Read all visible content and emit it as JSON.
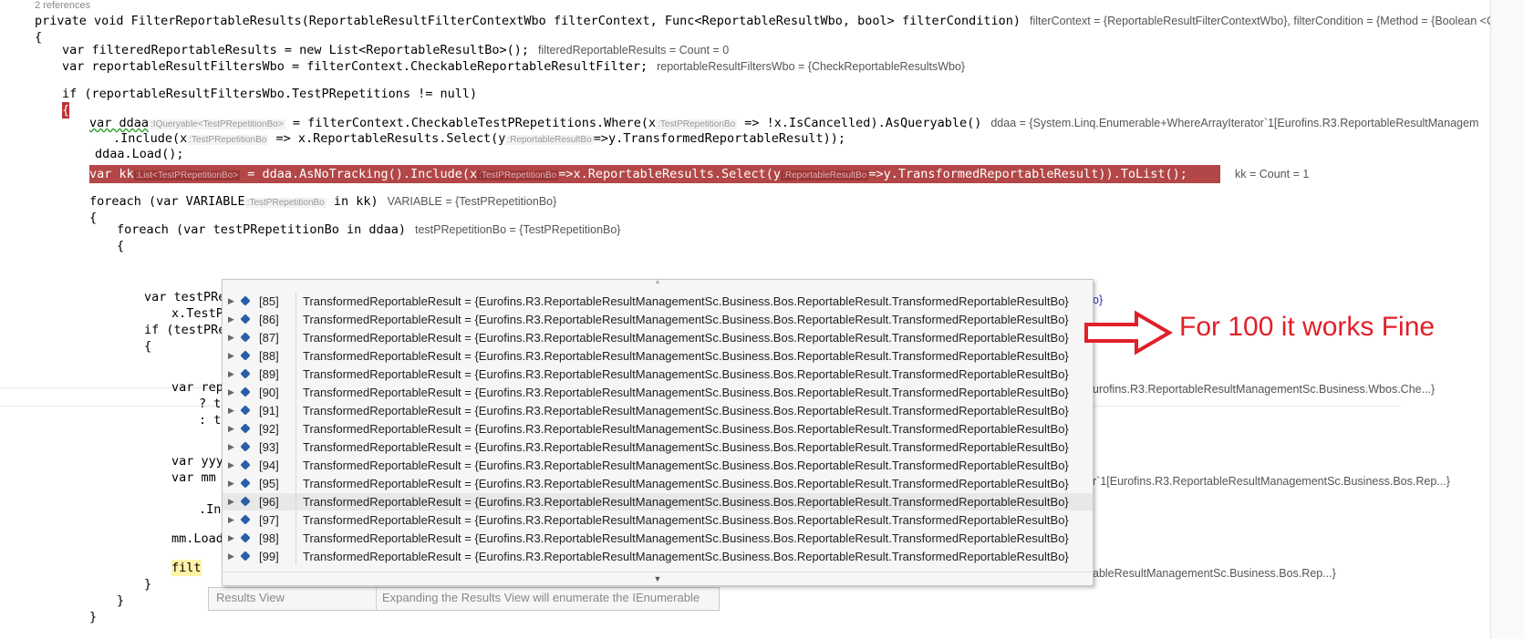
{
  "header": {
    "references": "2 references"
  },
  "code": {
    "l1": "private void FilterReportableResults(ReportableResultFilterContextWbo filterContext, Func<ReportableResultWbo, bool> filterCondition)",
    "l1_dt": "filterContext = {ReportableResultFilterContextWbo}, filterCondition = {Method = {Boolean <ConvertU",
    "l2": "{",
    "l3": "var filteredReportableResults = new List<ReportableResultBo>();",
    "l3_dt": "filteredReportableResults = Count = 0",
    "l4": "var reportableResultFiltersWbo = filterContext.CheckableReportableResultFilter;",
    "l4_dt": "reportableResultFiltersWbo = {CheckReportableResultsWbo}",
    "l5": "if (reportableResultFiltersWbo.TestPRepetitions != null)",
    "l6": "{",
    "l7a": "var ddaa",
    "l7h1": ":IQueryable<TestPRepetitionBo>",
    "l7b": " = filterContext.CheckableTestPRepetitions.Where(x",
    "l7h2": ":TestPRepetitionBo",
    "l7c": " => !x.IsCancelled).AsQueryable()",
    "l7_dt": "ddaa = {System.Linq.Enumerable+WhereArrayIterator`1[Eurofins.R3.ReportableResultManagem",
    "l8a": ".Include(x",
    "l8h1": ":TestPRepetitionBo",
    "l8b": " => x.ReportableResults.Select(y",
    "l8h2": ":ReportableResultBo",
    "l8c": "=>y.TransformedReportableResult));",
    "l9": "ddaa.Load();",
    "l10a": "var kk",
    "l10h1": ":List<TestPRepetitionBo>",
    "l10b": " = ddaa.AsNoTracking().Include(x",
    "l10h2": ":TestPRepetitionBo",
    "l10c": "=>x.ReportableResults.Select(y",
    "l10h3": ":ReportableResultBo",
    "l10d": "=>y.TransformedReportableResult)).ToList();",
    "l10_dt": "kk = Count = 1",
    "l11a": "foreach (var VARIABLE",
    "l11h": ":TestPRepetitionBo",
    "l11b": " in kk)",
    "l11_dt": "VARIABLE = {TestPRepetitionBo}",
    "l12": "{",
    "l13": "foreach (var testPRepetitionBo in ddaa)",
    "l13_dt": "testPRepetitionBo = {TestPRepetitionBo}",
    "l14": "{",
    "l15": "var testPRe",
    "l16": "x.TestP",
    "l17": "if (testPRe",
    "l18": "{",
    "l19": "var rep",
    "l20": "? t",
    "l21": ": t",
    "l22": "var yyy",
    "l23": "var mm",
    "l24": ".In",
    "l25": "mm.Load",
    "l26": "filt",
    "l27": "}",
    "l28": "}",
    "l29": "}"
  },
  "annotations": {
    "a1": "o}",
    "a2": "urofins.R3.ReportableResultManagementSc.Business.Wbos.Che...}",
    "a3": "r`1[Eurofins.R3.ReportableResultManagementSc.Business.Bos.Rep...}",
    "a4": "ableResultManagementSc.Business.Bos.Rep...}"
  },
  "tooltip": {
    "rows": [
      {
        "index": "[85]",
        "value": "TransformedReportableResult = {Eurofins.R3.ReportableResultManagementSc.Business.Bos.ReportableResult.TransformedReportableResultBo}"
      },
      {
        "index": "[86]",
        "value": "TransformedReportableResult = {Eurofins.R3.ReportableResultManagementSc.Business.Bos.ReportableResult.TransformedReportableResultBo}"
      },
      {
        "index": "[87]",
        "value": "TransformedReportableResult = {Eurofins.R3.ReportableResultManagementSc.Business.Bos.ReportableResult.TransformedReportableResultBo}"
      },
      {
        "index": "[88]",
        "value": "TransformedReportableResult = {Eurofins.R3.ReportableResultManagementSc.Business.Bos.ReportableResult.TransformedReportableResultBo}"
      },
      {
        "index": "[89]",
        "value": "TransformedReportableResult = {Eurofins.R3.ReportableResultManagementSc.Business.Bos.ReportableResult.TransformedReportableResultBo}"
      },
      {
        "index": "[90]",
        "value": "TransformedReportableResult = {Eurofins.R3.ReportableResultManagementSc.Business.Bos.ReportableResult.TransformedReportableResultBo}"
      },
      {
        "index": "[91]",
        "value": "TransformedReportableResult = {Eurofins.R3.ReportableResultManagementSc.Business.Bos.ReportableResult.TransformedReportableResultBo}"
      },
      {
        "index": "[92]",
        "value": "TransformedReportableResult = {Eurofins.R3.ReportableResultManagementSc.Business.Bos.ReportableResult.TransformedReportableResultBo}"
      },
      {
        "index": "[93]",
        "value": "TransformedReportableResult = {Eurofins.R3.ReportableResultManagementSc.Business.Bos.ReportableResult.TransformedReportableResultBo}"
      },
      {
        "index": "[94]",
        "value": "TransformedReportableResult = {Eurofins.R3.ReportableResultManagementSc.Business.Bos.ReportableResult.TransformedReportableResultBo}"
      },
      {
        "index": "[95]",
        "value": "TransformedReportableResult = {Eurofins.R3.ReportableResultManagementSc.Business.Bos.ReportableResult.TransformedReportableResultBo}"
      },
      {
        "index": "[96]",
        "value": "TransformedReportableResult = {Eurofins.R3.ReportableResultManagementSc.Business.Bos.ReportableResult.TransformedReportableResultBo}"
      },
      {
        "index": "[97]",
        "value": "TransformedReportableResult = {Eurofins.R3.ReportableResultManagementSc.Business.Bos.ReportableResult.TransformedReportableResultBo}"
      },
      {
        "index": "[98]",
        "value": "TransformedReportableResult = {Eurofins.R3.ReportableResultManagementSc.Business.Bos.ReportableResult.TransformedReportableResultBo}"
      },
      {
        "index": "[99]",
        "value": "TransformedReportableResult = {Eurofins.R3.ReportableResultManagementSc.Business.Bos.ReportableResult.TransformedReportableResultBo}"
      }
    ]
  },
  "results_view": {
    "label": "Results View",
    "hint": "Expanding the Results View will enumerate the IEnumerable"
  },
  "callout": {
    "text": "For 100 it works Fine",
    "color": "#e0202a"
  },
  "colors": {
    "keyword": "#0000ff",
    "type": "#2b91af",
    "breakpoint": "#b34747"
  }
}
